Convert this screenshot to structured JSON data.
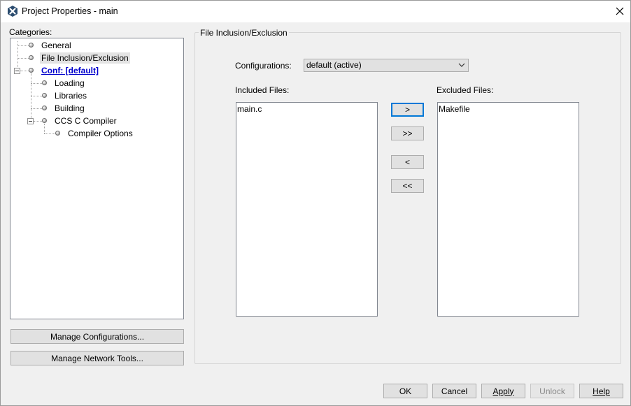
{
  "window": {
    "title": "Project Properties - main"
  },
  "categories": {
    "label": "Categories:",
    "items": [
      {
        "label": "General"
      },
      {
        "label": "File Inclusion/Exclusion"
      },
      {
        "label": "Conf: [default]"
      },
      {
        "label": "Loading"
      },
      {
        "label": "Libraries"
      },
      {
        "label": "Building"
      },
      {
        "label": "CCS C Compiler"
      },
      {
        "label": "Compiler Options"
      }
    ],
    "selected": "File Inclusion/Exclusion"
  },
  "left_buttons": {
    "manage_configurations": "Manage Configurations...",
    "manage_network_tools": "Manage Network Tools..."
  },
  "panel": {
    "title": "File Inclusion/Exclusion",
    "configurations_label": "Configurations:",
    "configurations_value": "default (active)",
    "included_label": "Included Files:",
    "excluded_label": "Excluded Files:",
    "included_files": [
      "main.c"
    ],
    "excluded_files": [
      "Makefile"
    ],
    "move_buttons": {
      "right": ">",
      "all_right": ">>",
      "left": "<",
      "all_left": "<<"
    }
  },
  "footer": {
    "ok": "OK",
    "cancel": "Cancel",
    "apply": "Apply",
    "unlock": "Unlock",
    "help": "Help",
    "unlock_disabled": true
  },
  "colors": {
    "link": "#0000cc",
    "focus": "#0078d7",
    "background": "#f0f0f0"
  }
}
